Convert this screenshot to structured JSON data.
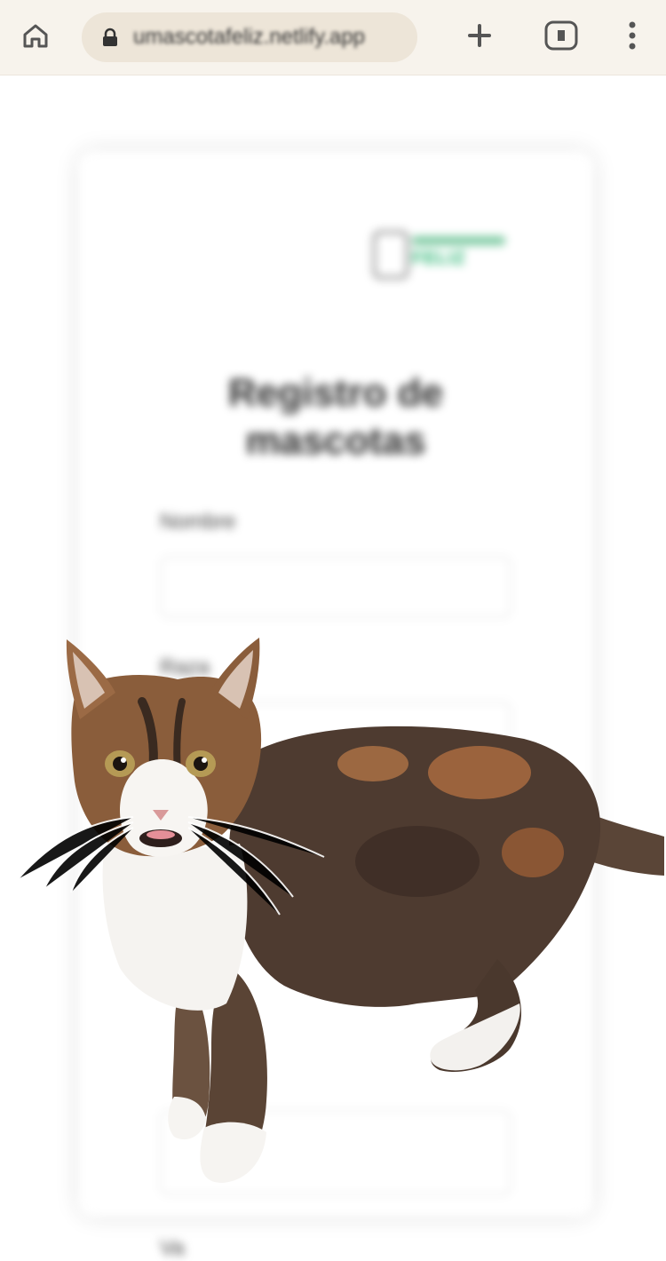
{
  "browser": {
    "url": "umascotafeliz.netlify.app",
    "home_icon": "home-icon",
    "lock_icon": "lock-icon",
    "new_tab_icon": "plus-icon",
    "tabs_icon": "tabs-icon",
    "menu_icon": "kebab-menu-icon"
  },
  "page": {
    "logo_text": "FELIZ",
    "title": "Registro de mascotas",
    "fields": [
      {
        "label": "Nombre",
        "value": ""
      },
      {
        "label": "Raza",
        "value": ""
      }
    ],
    "bottom_label_fragment": "Va"
  },
  "overlay": {
    "subject": "calico cat"
  },
  "colors": {
    "toolbar_bg": "#f7f3ec",
    "urlbar_bg": "#ede5d8",
    "brand_green": "#1eb06a"
  }
}
